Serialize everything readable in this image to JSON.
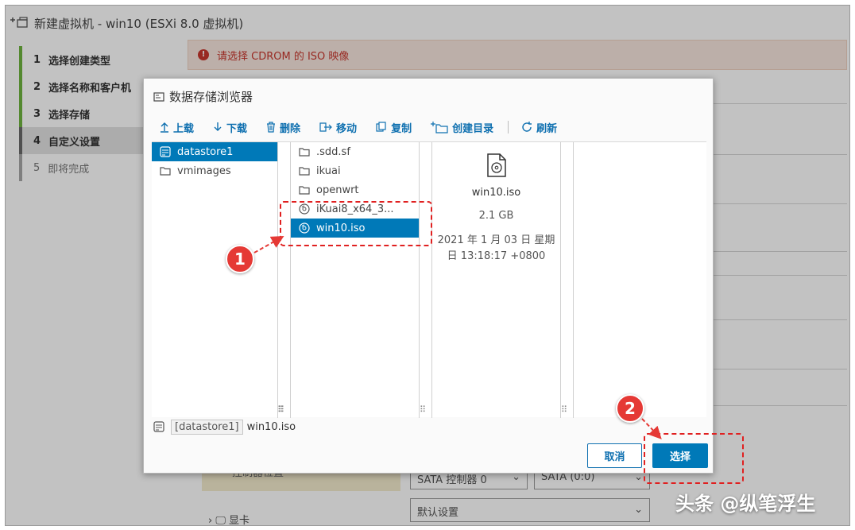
{
  "wizard": {
    "title": "新建虚拟机 - win10 (ESXi 8.0 虚拟机)",
    "steps": [
      {
        "num": "1",
        "label": "选择创建类型"
      },
      {
        "num": "2",
        "label": "选择名称和客户机"
      },
      {
        "num": "3",
        "label": "选择存储"
      },
      {
        "num": "4",
        "label": "自定义设置"
      },
      {
        "num": "5",
        "label": "即将完成"
      }
    ],
    "alert": "请选择 CDROM 的 ISO 映像",
    "controller_label": "控制器位置",
    "controller_select": "SATA 控制器 0",
    "controller_slot": "SATA (0:0)",
    "gpu_label": "显卡",
    "gpu_select": "默认设置"
  },
  "dialog": {
    "title": "数据存储浏览器",
    "toolbar": {
      "upload": "上载",
      "download": "下载",
      "delete": "删除",
      "move": "移动",
      "copy": "复制",
      "mkdir": "创建目录",
      "refresh": "刷新"
    },
    "datastores": [
      "datastore1",
      "vmimages"
    ],
    "files": [
      {
        "name": ".sdd.sf",
        "icon": "folder-icon"
      },
      {
        "name": "ikuai",
        "icon": "folder-icon"
      },
      {
        "name": "openwrt",
        "icon": "folder-icon"
      },
      {
        "name": "iKuai8_x64_3...",
        "icon": "disc-icon"
      },
      {
        "name": "win10.iso",
        "icon": "disc-icon"
      }
    ],
    "preview": {
      "name": "win10.iso",
      "size": "2.1 GB",
      "date": "2021 年 1 月 03 日 星期日 13:18:17 +0800"
    },
    "path": {
      "datastore": "[datastore1]",
      "file": "win10.iso"
    },
    "cancel_label": "取消",
    "select_label": "选择"
  },
  "annotations": {
    "badge1": "1",
    "badge2": "2",
    "watermark": "头条 @纵笔浮生",
    "color": "#e53935"
  },
  "colors": {
    "accent": "#0079b8",
    "link": "#0f70b0",
    "alert": "#c8372d",
    "step_done": "#6db33f"
  }
}
